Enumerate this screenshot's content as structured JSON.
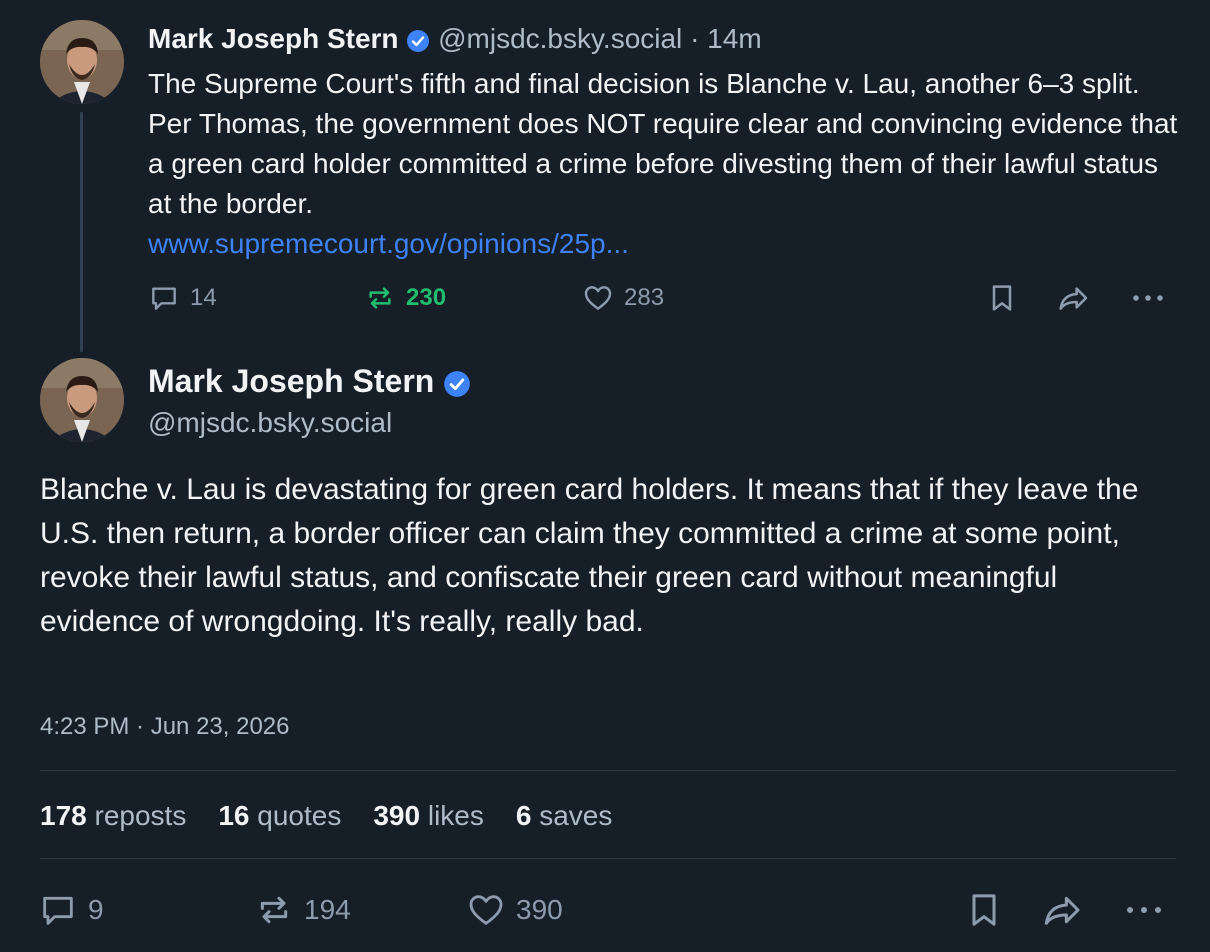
{
  "parent_post": {
    "author_name": "Mark Joseph Stern",
    "handle": "@mjsdc.bsky.social",
    "time_separator": "·",
    "time_ago": "14m",
    "text": "The Supreme Court's fifth and final decision is Blanche v. Lau, another 6–3 split. Per Thomas, the government does NOT require clear and convincing evidence that a green card holder committed a crime before divesting them of their lawful status at the border.",
    "link": "www.supremecourt.gov/opinions/25p...",
    "reply_count": "14",
    "repost_count": "230",
    "like_count": "283"
  },
  "main_post": {
    "author_name": "Mark Joseph Stern",
    "handle": "@mjsdc.bsky.social",
    "text": "Blanche v. Lau is devastating for green card holders. It means that if they leave the U.S. then return, a border officer can claim they committed a crime at some point, revoke their lawful status, and confiscate their green card without meaningful evidence of wrongdoing. It's really, really bad.",
    "timestamp": "4:23 PM · Jun 23, 2026",
    "stats": {
      "reposts_value": "178",
      "reposts_label": "reposts",
      "quotes_value": "16",
      "quotes_label": "quotes",
      "likes_value": "390",
      "likes_label": "likes",
      "saves_value": "6",
      "saves_label": "saves"
    },
    "reply_count": "9",
    "repost_count": "194",
    "like_count": "390"
  },
  "colors": {
    "background": "#161e27",
    "link": "#3d82f6",
    "verified": "#3d82f6",
    "repost_active": "#20bc6f",
    "muted": "#8d9cad"
  },
  "icons": [
    "verified-badge-icon",
    "reply-icon",
    "repost-icon",
    "like-icon",
    "bookmark-icon",
    "share-icon",
    "more-icon"
  ]
}
